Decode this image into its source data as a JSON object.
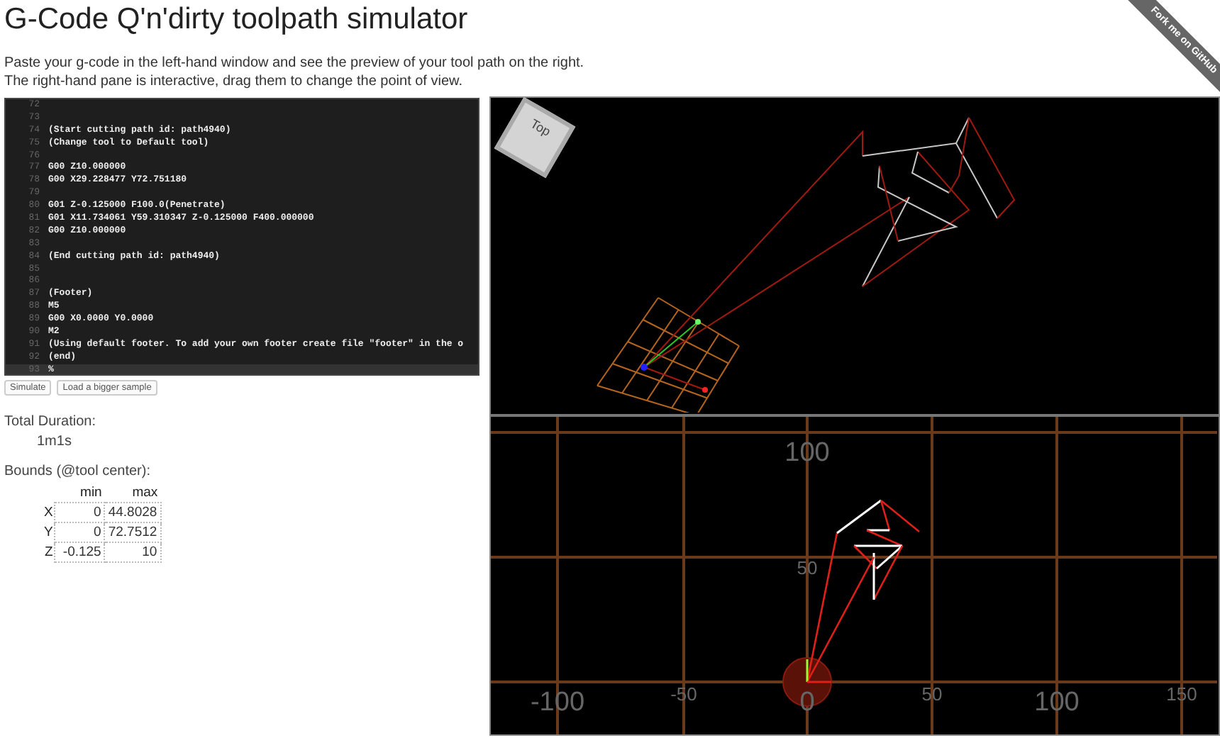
{
  "page": {
    "title": "G-Code Q'n'dirty toolpath simulator",
    "description": [
      "Paste your g-code in the left-hand window and see the preview of your tool path on the right.",
      "The right-hand pane is interactive, drag them to change the point of view."
    ]
  },
  "ribbon": "Fork me on GitHub",
  "editor": {
    "lines": [
      {
        "number": "72",
        "selected": false
      },
      {
        "number": "73",
        "selected": false
      },
      {
        "number": "74",
        "text": "(Start cutting path id: path4940)",
        "selected": false
      },
      {
        "number": "75",
        "text": "(Change tool to Default tool)",
        "selected": false
      },
      {
        "number": "76",
        "selected": false
      },
      {
        "number": "77",
        "text": "G00 Z10.000000",
        "selected": false
      },
      {
        "number": "78",
        "text": "G00 X29.228477 Y72.751180",
        "selected": false
      },
      {
        "number": "79",
        "selected": false
      },
      {
        "number": "80",
        "text": "G01 Z-0.125000 F100.0(Penetrate)",
        "selected": false
      },
      {
        "number": "81",
        "text": "G01 X11.734061 Y59.310347 Z-0.125000 F400.000000",
        "selected": false
      },
      {
        "number": "82",
        "text": "G00 Z10.000000",
        "selected": false
      },
      {
        "number": "83",
        "selected": false
      },
      {
        "number": "84",
        "text": "(End cutting path id: path4940)",
        "selected": false
      },
      {
        "number": "85",
        "selected": false
      },
      {
        "number": "86",
        "selected": false
      },
      {
        "number": "87",
        "text": "(Footer)",
        "selected": false
      },
      {
        "number": "88",
        "text": "M5",
        "selected": false
      },
      {
        "number": "89",
        "text": "G00 X0.0000 Y0.0000",
        "selected": false
      },
      {
        "number": "90",
        "text": "M2",
        "selected": false
      },
      {
        "number": "91",
        "text": "(Using default footer. To add your own footer create file \"footer\" in the o",
        "selected": false
      },
      {
        "number": "92",
        "text": "(end)",
        "selected": false
      },
      {
        "number": "93",
        "text": "%",
        "selected": true
      }
    ]
  },
  "buttons": [
    "Simulate",
    "Load a bigger sample"
  ],
  "duration": {
    "label": "Total Duration:",
    "value": "1m1s"
  },
  "bounds": {
    "label": "Bounds (@tool center):",
    "columns": [
      "min",
      "max"
    ],
    "rows": [
      {
        "axis": "X",
        "min": "0",
        "max": "44.8028"
      },
      {
        "axis": "Y",
        "min": "0",
        "max": "72.7512"
      },
      {
        "axis": "Z",
        "min": "-0.125",
        "max": "10"
      }
    ]
  },
  "view_3d": {
    "cube_face": "Top"
  },
  "view_top": {
    "y_labels": [
      {
        "text": "100",
        "kind": "large"
      },
      {
        "text": "50",
        "kind": "small"
      }
    ],
    "x_labels": [
      {
        "text": "-100",
        "kind": "large"
      },
      {
        "text": "-50",
        "kind": "small"
      },
      {
        "text": "0",
        "kind": "large"
      },
      {
        "text": "50",
        "kind": "small"
      },
      {
        "text": "100",
        "kind": "large"
      },
      {
        "text": "150",
        "kind": "small"
      }
    ]
  }
}
